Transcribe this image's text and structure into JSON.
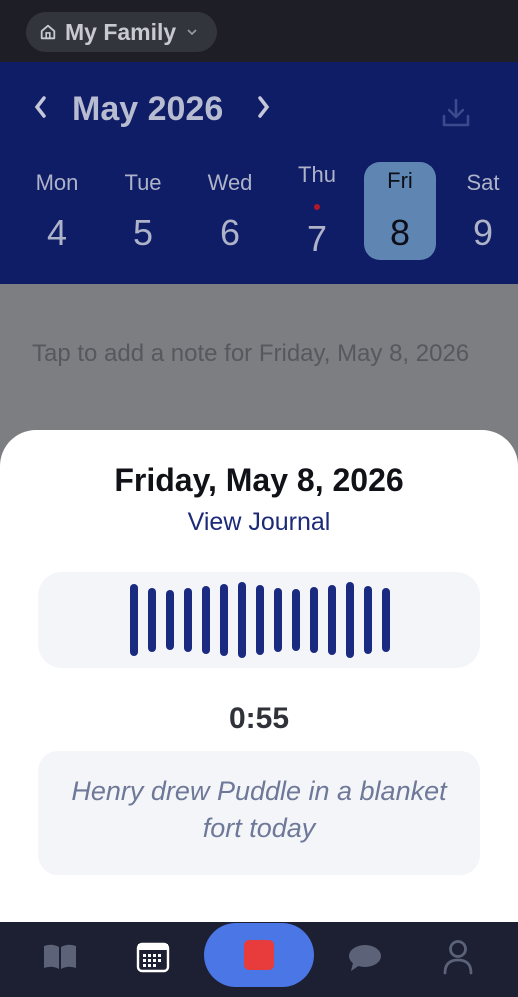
{
  "header": {
    "family_label": "My Family",
    "icons": {
      "home": "home-icon",
      "chevron": "chevron-down-icon"
    }
  },
  "calendar": {
    "month_title": "May 2026",
    "prev_icon": "chevron-left-icon",
    "next_icon": "chevron-right-icon",
    "download_icon": "download-icon",
    "days": [
      {
        "name": "Mon",
        "num": "4"
      },
      {
        "name": "Tue",
        "num": "5"
      },
      {
        "name": "Wed",
        "num": "6"
      },
      {
        "name": "Thu",
        "num": "7",
        "has_entry": true
      },
      {
        "name": "Fri",
        "num": "8",
        "selected": true
      },
      {
        "name": "Sat",
        "num": "9"
      }
    ]
  },
  "note": {
    "placeholder": "Tap to add a note for Friday, May 8, 2026"
  },
  "sheet": {
    "date_title": "Friday, May 8, 2026",
    "view_journal": "View Journal",
    "timer": "0:55",
    "transcript": "Henry drew Puddle in a blanket fort today",
    "waveform_bars": 15
  },
  "tabbar": {
    "items": [
      {
        "name": "journal-tab",
        "icon": "book-icon"
      },
      {
        "name": "calendar-tab",
        "icon": "calendar-icon",
        "active": true
      },
      {
        "name": "record-tab",
        "icon": "stop-icon"
      },
      {
        "name": "chat-tab",
        "icon": "chat-bubble-icon"
      },
      {
        "name": "profile-tab",
        "icon": "person-icon"
      }
    ]
  },
  "colors": {
    "calendar_bg": "#0f1c66",
    "selected_day": "#5f86b3",
    "accent": "#1c2a78",
    "record_button": "#4b76e6",
    "stop": "#e83b3b"
  }
}
